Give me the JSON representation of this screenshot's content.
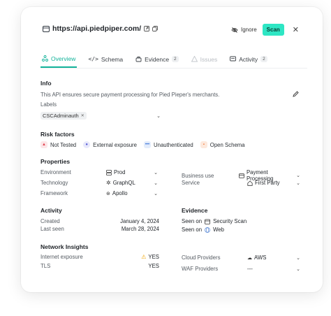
{
  "header": {
    "url": "https://api.piedpiper.com/",
    "ignore_label": "Ignore",
    "scan_label": "Scan",
    "close_glyph": "✕"
  },
  "tabs": [
    {
      "label": "Overview",
      "state": "active",
      "icon": "overview-icon"
    },
    {
      "label": "Schema",
      "icon": "code-icon"
    },
    {
      "label": "Evidence",
      "count": "2",
      "icon": "evidence-icon"
    },
    {
      "label": "Issues",
      "state": "disabled",
      "icon": "issues-icon"
    },
    {
      "label": "Activity",
      "count": "2",
      "icon": "activity-icon"
    }
  ],
  "info": {
    "title": "Info",
    "description": "This API ensures secure payment processing for Pied Pieper's merchants.",
    "labels_title": "Labels",
    "label_chip": "CSCAdminauth"
  },
  "risk": {
    "title": "Risk factors",
    "items": [
      {
        "label": "Not Tested",
        "color": "#e0424f"
      },
      {
        "label": "External exposure",
        "color": "#5b5fd6"
      },
      {
        "label": "Unauthenticated",
        "color": "#2f6ad6"
      },
      {
        "label": "Open Schema",
        "color": "#f07a3c"
      }
    ]
  },
  "properties": {
    "title": "Properties",
    "left": [
      {
        "key": "Environment",
        "value": "Prod"
      },
      {
        "key": "Technology",
        "value": "GraphQL"
      },
      {
        "key": "Framework",
        "value": "Apollo"
      }
    ],
    "right": [
      {
        "key": "Business use",
        "value": "Payment Processing"
      },
      {
        "key": "Service",
        "value": "First Party"
      }
    ]
  },
  "activity": {
    "title": "Activity",
    "rows": [
      {
        "key": "Created",
        "value": "January 4, 2024"
      },
      {
        "key": "Last seen",
        "value": "March 28, 2024"
      }
    ]
  },
  "evidence": {
    "title": "Evidence",
    "rows": [
      {
        "key": "Seen on",
        "value": "Security Scan"
      },
      {
        "key": "Seen on",
        "value": "Web"
      }
    ]
  },
  "network": {
    "title": "Network Insights",
    "left": [
      {
        "key": "Internet exposure",
        "value": "YES"
      },
      {
        "key": "TLS",
        "value": "YES"
      }
    ],
    "right": [
      {
        "key": "Cloud Providers",
        "value": "AWS"
      },
      {
        "key": "WAF Providers",
        "value": "---"
      }
    ]
  },
  "colors": {
    "accent": "#13b39a",
    "scan_button": "#2ee6c4",
    "warning": "#f0a400"
  }
}
